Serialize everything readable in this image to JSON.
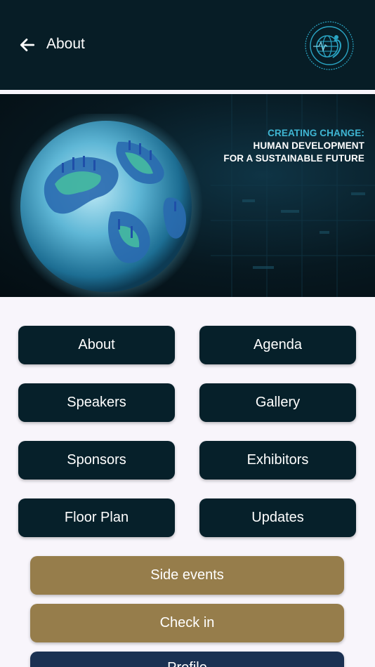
{
  "header": {
    "title": "About"
  },
  "banner": {
    "line1": "CREATING CHANGE:",
    "line2": "HUMAN DEVELOPMENT",
    "line3": "FOR A SUSTAINABLE FUTURE"
  },
  "menu": {
    "about": "About",
    "agenda": "Agenda",
    "speakers": "Speakers",
    "gallery": "Gallery",
    "sponsors": "Sponsors",
    "exhibitors": "Exhibitors",
    "floor_plan": "Floor Plan",
    "updates": "Updates",
    "side_events": "Side events",
    "check_in": "Check in",
    "profile": "Profile"
  },
  "colors": {
    "header_bg": "#071d26",
    "button_dark": "#06202a",
    "button_gold": "#967d4b",
    "button_navy": "#1b3152",
    "accent_teal": "#3fb6d3"
  }
}
